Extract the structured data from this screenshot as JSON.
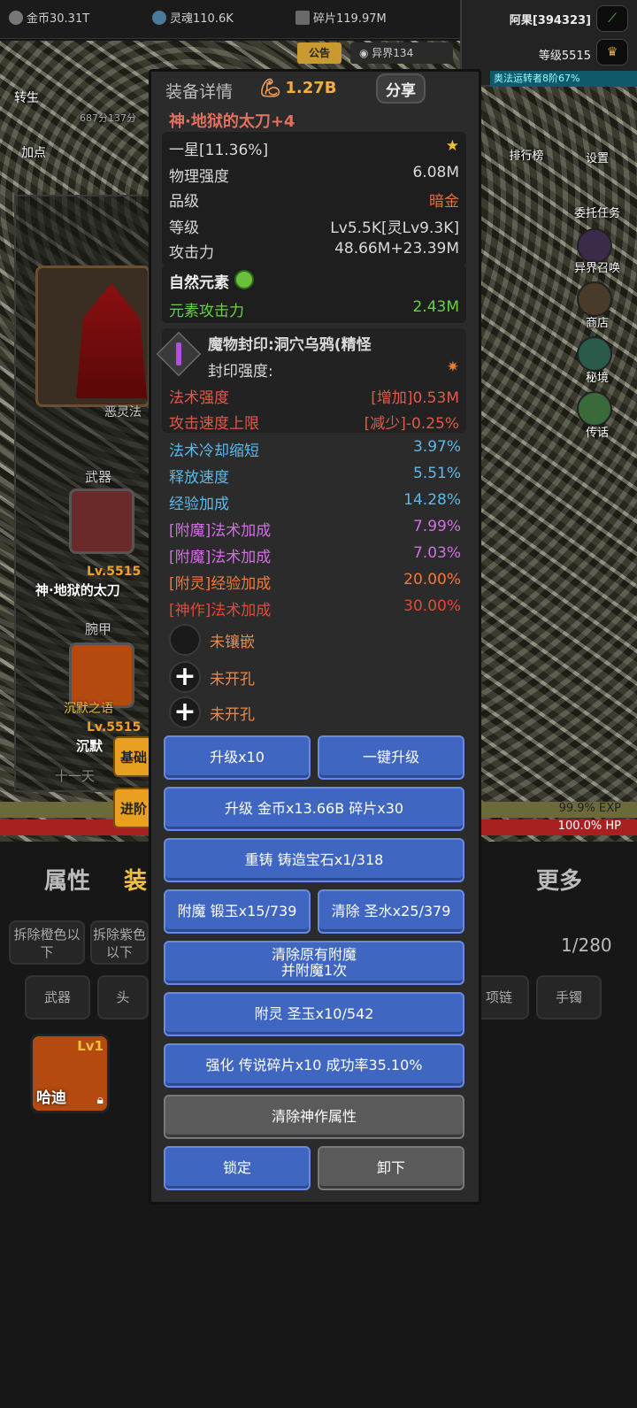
{
  "top": {
    "gold": "金币30.31T",
    "soul": "灵魂110.6K",
    "shards": "碎片119.97M",
    "player_name": "阿果[394323]",
    "player_level": "等级5515",
    "progress_text": "奥法运转者8阶67%",
    "notice": "公告",
    "otherworld": "异界134"
  },
  "left_menu": {
    "rebirth": "转生",
    "add_points": "加点",
    "score": "687分137分"
  },
  "right_menu": [
    "排行榜",
    "设置",
    "委托任务",
    "异界召唤",
    "商店",
    "秘境",
    "传话"
  ],
  "char_card": {
    "portrait_name": "恶灵法",
    "weapon_label": "武器",
    "weapon_level": "Lv.5515",
    "weapon_name": "神·地狱的太刀",
    "bracer_label": "腕甲",
    "bracer_item": "沉默之语",
    "bracer_level": "Lv.5515",
    "bracer_name": "沉默",
    "hidden_text": "十一天"
  },
  "bars": {
    "exp": "99.9% EXP",
    "hp": "100.0% HP"
  },
  "bottom_tabs": [
    "属性",
    "装",
    "更多"
  ],
  "filters": [
    "拆除橙色以下",
    "拆除紫色以下"
  ],
  "slot_filters": [
    "武器",
    "头",
    "项链",
    "手镯"
  ],
  "page": "1/280",
  "inventory_item": {
    "level": "Lv1",
    "name": "哈迪"
  },
  "dialog": {
    "title": "装备详情",
    "power": "1.27B",
    "share": "分享",
    "item_name": "神·地狱的太刀+4",
    "star_line": "一星[11.36%]",
    "stats": [
      {
        "k": "物理强度",
        "v": "6.08M",
        "vc": "#d9d9d9"
      },
      {
        "k": "品级",
        "v": "暗金",
        "vc": "#e07040"
      },
      {
        "k": "等级",
        "v": "Lv5.5K[灵Lv9.3K]",
        "vc": "#d9d9d9"
      },
      {
        "k": "攻击力",
        "v": "48.66M+23.39M",
        "vc": "#d9d9d9"
      }
    ],
    "element_title": "自然元素",
    "element_attack_k": "元素攻击力",
    "element_attack_v": "2.43M",
    "seal_title": "魔物封印:洞穴乌鸦(精怪",
    "seal_strength": "封印强度:",
    "seal_stats": [
      {
        "k": "法术强度",
        "v": "[增加]0.53M"
      },
      {
        "k": "攻击速度上限",
        "v": "[减少]-0.25%"
      }
    ],
    "affixes": [
      {
        "k": "法术冷却缩短",
        "v": "3.97%",
        "c": "#5fb8e8"
      },
      {
        "k": "释放速度",
        "v": "5.51%",
        "c": "#5fb8e8"
      },
      {
        "k": "经验加成",
        "v": "14.28%",
        "c": "#5fb8e8"
      },
      {
        "k": "[附魔]法术加成",
        "v": "7.99%",
        "c": "#d070e0"
      },
      {
        "k": "[附魔]法术加成",
        "v": "7.03%",
        "c": "#d070e0"
      },
      {
        "k": "[附灵]经验加成",
        "v": "20.00%",
        "c": "#f07a3a"
      },
      {
        "k": "[神作]法术加成",
        "v": "30.00%",
        "c": "#e04a3a"
      }
    ],
    "sockets": [
      "未镶嵌",
      "未开孔",
      "未开孔"
    ],
    "tab_basic": "基础",
    "tab_advanced": "进阶",
    "buttons": {
      "upgrade10": "升级x10",
      "one_click": "一键升级",
      "upgrade_cost": "升级 金币x13.66B 碎片x30",
      "reforge": "重铸 铸造宝石x1/318",
      "enchant": "附魔 锻玉x15/739",
      "clear": "清除 圣水x25/379",
      "clear_enchant_1": "清除原有附魔",
      "clear_enchant_2": "并附魔1次",
      "spirit": "附灵 圣玉x10/542",
      "strengthen": "强化 传说碎片x10 成功率35.10%",
      "clear_divine": "清除神作属性",
      "lock": "锁定",
      "unequip": "卸下"
    }
  }
}
